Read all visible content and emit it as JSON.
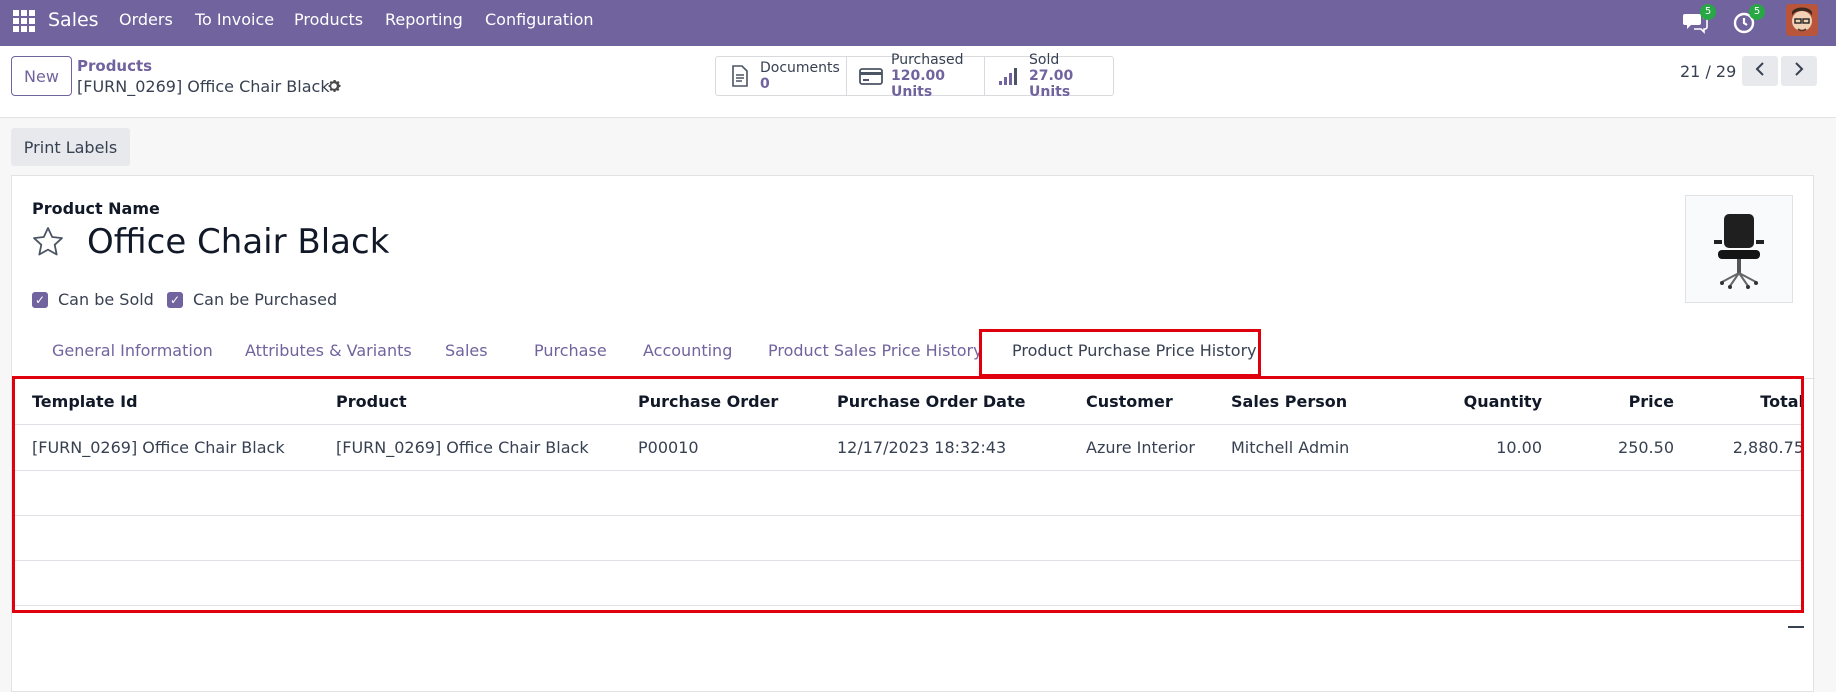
{
  "navbar": {
    "brand": "Sales",
    "menu": [
      "Orders",
      "To Invoice",
      "Products",
      "Reporting",
      "Configuration"
    ],
    "messages_count": "5",
    "activities_count": "5"
  },
  "control_panel": {
    "new_label": "New",
    "breadcrumb_parent": "Products",
    "breadcrumb_current": "[FURN_0269] Office Chair Black",
    "smart_buttons": [
      {
        "label": "Documents",
        "value": "0"
      },
      {
        "label": "Purchased",
        "value": "120.00 Units"
      },
      {
        "label": "Sold",
        "value": "27.00 Units"
      }
    ],
    "pager": "21 / 29"
  },
  "actions": {
    "print_labels": "Print Labels"
  },
  "form": {
    "field_label": "Product Name",
    "product_name": "Office Chair Black",
    "can_be_sold": "Can be Sold",
    "can_be_purchased": "Can be Purchased"
  },
  "tabs": [
    "General Information",
    "Attributes & Variants",
    "Sales",
    "Purchase",
    "Accounting",
    "Product Sales Price History",
    "Product Purchase Price History"
  ],
  "table": {
    "columns": [
      "Template Id",
      "Product",
      "Purchase Order",
      "Purchase Order Date",
      "Customer",
      "Sales Person",
      "Quantity",
      "Price",
      "Total"
    ],
    "rows": [
      [
        "[FURN_0269] Office Chair Black",
        "[FURN_0269] Office Chair Black",
        "P00010",
        "12/17/2023 18:32:43",
        "Azure Interior",
        "Mitchell Admin",
        "10.00",
        "250.50",
        "2,880.75"
      ]
    ]
  },
  "colors": {
    "brand": "#71639e",
    "highlight": "#e0000d"
  }
}
